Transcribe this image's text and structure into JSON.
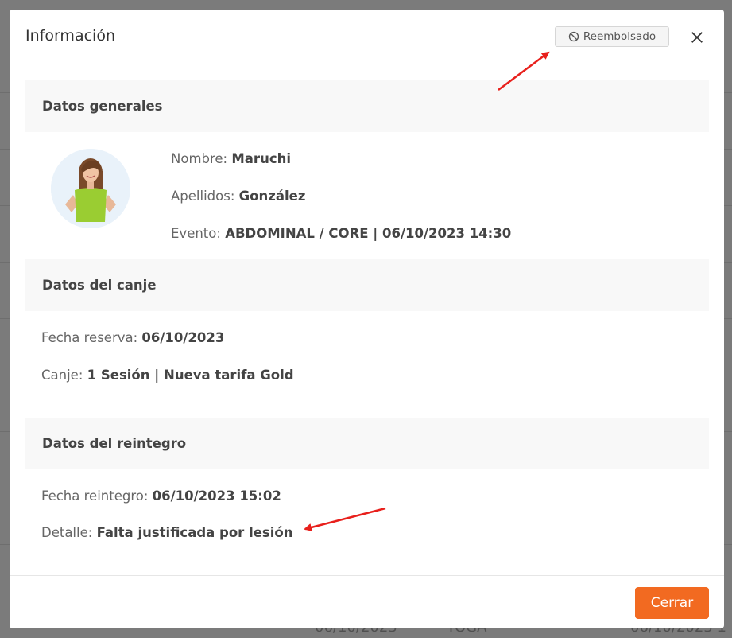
{
  "modal": {
    "title": "Información",
    "status_badge": "Reembolsado",
    "close_label": "Cerrar"
  },
  "general": {
    "heading": "Datos generales",
    "nombre_label": "Nombre:",
    "nombre_value": "Maruchi",
    "apellidos_label": "Apellidos:",
    "apellidos_value": "González",
    "evento_label": "Evento:",
    "evento_value": "ABDOMINAL / CORE | 06/10/2023 14:30"
  },
  "canje": {
    "heading": "Datos del canje",
    "fecha_label": "Fecha reserva:",
    "fecha_value": "06/10/2023",
    "canje_label": "Canje:",
    "canje_value": "1 Sesión | Nueva tarifa Gold"
  },
  "reintegro": {
    "heading": "Datos del reintegro",
    "fecha_label": "Fecha reintegro:",
    "fecha_value": "06/10/2023 15:02",
    "detalle_label": "Detalle:",
    "detalle_value": "Falta justificada por lesión"
  },
  "background": {
    "bottom_left": "06/10/2023",
    "bottom_mid": "YOGA",
    "bottom_right": "06/10/2023 1"
  },
  "colors": {
    "accent": "#f26a21",
    "annotation_arrow": "#e8201c"
  },
  "icons": {
    "badge": "ban-icon",
    "close": "close-x-icon"
  }
}
